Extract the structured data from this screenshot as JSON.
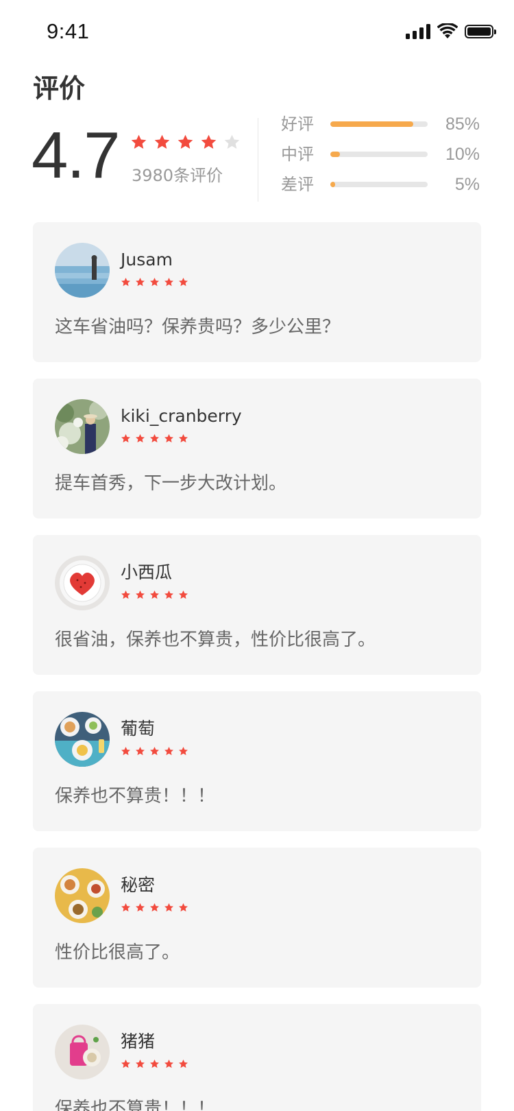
{
  "status_bar": {
    "time": "9:41"
  },
  "page": {
    "title": "评价"
  },
  "summary": {
    "score": "4.7",
    "stars": 4,
    "review_count": "3980条评价",
    "distribution": [
      {
        "label": "好评",
        "percent_text": "85%",
        "fraction": 0.85
      },
      {
        "label": "中评",
        "percent_text": "10%",
        "fraction": 0.1
      },
      {
        "label": "差评",
        "percent_text": "5%",
        "fraction": 0.05
      }
    ]
  },
  "colors": {
    "star_filled": "#f24b3e",
    "star_empty": "#e0e0e0",
    "bar_fill": "#f6a94c",
    "bar_track": "#e6e6e6",
    "card_bg": "#f5f5f5"
  },
  "reviews": [
    {
      "name": "Jusam",
      "stars": 5,
      "text": "这车省油吗？保养贵吗？多少公里？",
      "avatar_icon": "avatar-seaside-photo"
    },
    {
      "name": "kiki_cranberry",
      "stars": 5,
      "text": "提车首秀，下一步大改计划。",
      "avatar_icon": "avatar-flower-garden-photo"
    },
    {
      "name": "小西瓜",
      "stars": 5,
      "text": "很省油，保养也不算贵，性价比很高了。",
      "avatar_icon": "avatar-watermelon-heart-photo"
    },
    {
      "name": "葡萄",
      "stars": 5,
      "text": "保养也不算贵！！！",
      "avatar_icon": "avatar-food-plates-photo"
    },
    {
      "name": "秘密",
      "stars": 5,
      "text": "性价比很高了。",
      "avatar_icon": "avatar-food-table-photo"
    },
    {
      "name": "猪猪",
      "stars": 5,
      "text": "保养也不算贵！！！",
      "avatar_icon": "avatar-pink-bag-photo"
    }
  ]
}
